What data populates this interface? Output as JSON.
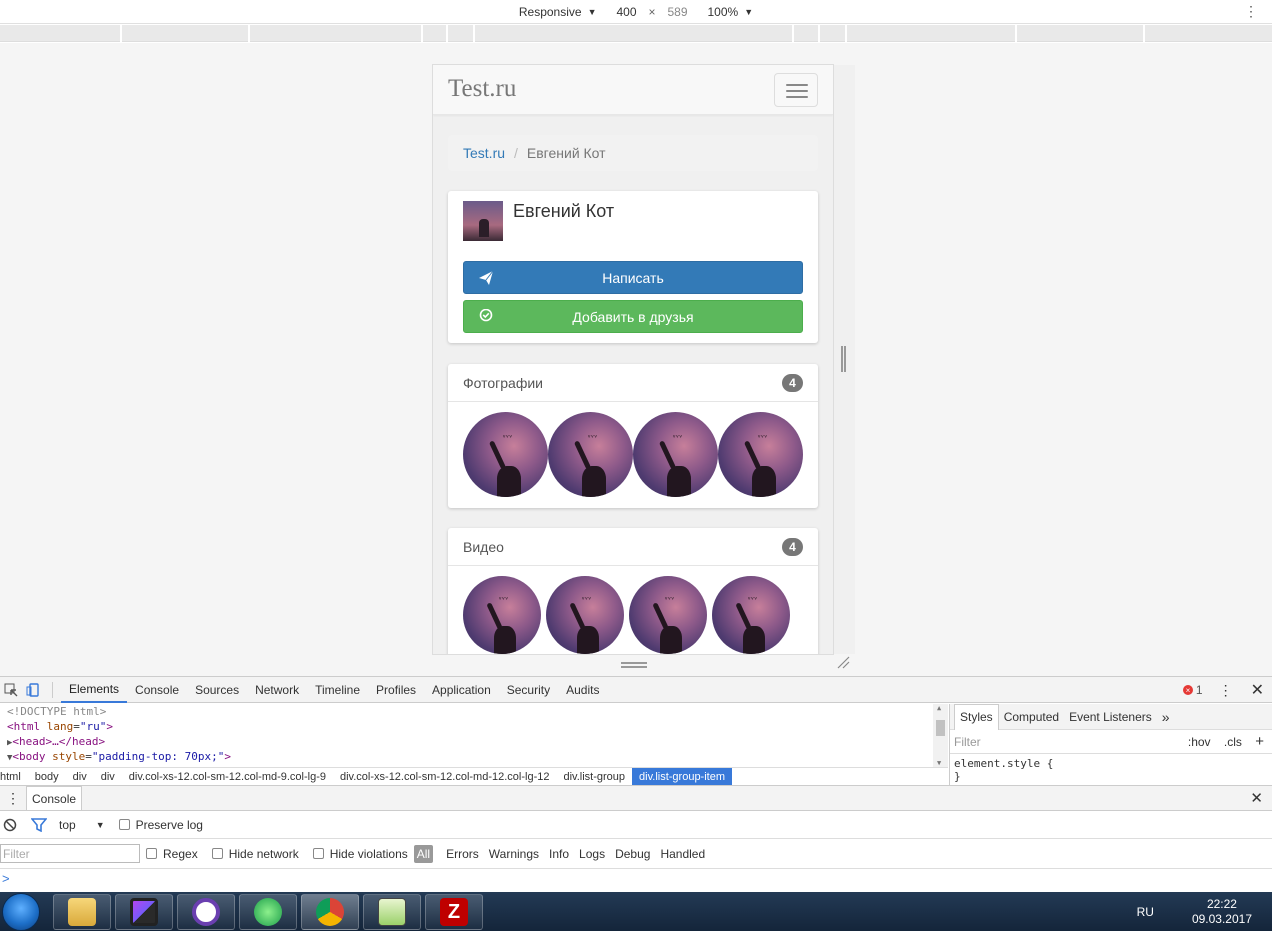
{
  "device_toolbar": {
    "mode": "Responsive",
    "width": "400",
    "height": "589",
    "zoom": "100%"
  },
  "page": {
    "brand": "Test.ru",
    "breadcrumb": {
      "home": "Test.ru",
      "separator": "/",
      "current": "Евгений Кот"
    },
    "profile": {
      "name": "Евгений Кот",
      "message_button": "Написать",
      "add_friend_button": "Добавить в друзья"
    },
    "photos": {
      "title": "Фотографии",
      "count": "4"
    },
    "videos": {
      "title": "Видео",
      "count": "4"
    }
  },
  "devtools": {
    "tabs": [
      "Elements",
      "Console",
      "Sources",
      "Network",
      "Timeline",
      "Profiles",
      "Application",
      "Security",
      "Audits"
    ],
    "error_count": "1",
    "dom_lines": {
      "doctype": "<!DOCTYPE html>",
      "html_open": "<html",
      "html_attr": "lang",
      "html_val": "\"ru\"",
      "head": "<head>…</head>",
      "body_open": "<body",
      "body_attr": "style",
      "body_val": "\"padding-top: 70px;\""
    },
    "breadcrumbs": [
      "html",
      "body",
      "div",
      "div",
      "div.col-xs-12.col-sm-12.col-md-9.col-lg-9",
      "div.col-xs-12.col-sm-12.col-md-12.col-lg-12",
      "div.list-group",
      "div.list-group-item"
    ],
    "styles_tabs": [
      "Styles",
      "Computed",
      "Event Listeners"
    ],
    "styles_more": "»",
    "styles_filter_placeholder": "Filter",
    "styles_hov": ":hov",
    "styles_cls": ".cls",
    "styles_add": "+",
    "element_style": "element.style {",
    "element_style_close": "}",
    "drawer_tab": "Console",
    "console_context": "top",
    "preserve_log": "Preserve log",
    "console_filter_placeholder": "Filter",
    "regex": "Regex",
    "hide_network": "Hide network",
    "hide_violations": "Hide violations",
    "levels": [
      "All",
      "Errors",
      "Warnings",
      "Info",
      "Logs",
      "Debug",
      "Handled"
    ],
    "prompt": ">"
  },
  "taskbar": {
    "language": "RU",
    "time": "22:22",
    "date": "09.03.2017",
    "apps": [
      "file-explorer",
      "phpstorm",
      "github",
      "app-green",
      "chrome",
      "notepad-plus-plus",
      "filezilla"
    ]
  },
  "colors": {
    "primary": "#337ab7",
    "success": "#5cb85c",
    "badge": "#777777",
    "devtools_accent": "#3879d9"
  }
}
